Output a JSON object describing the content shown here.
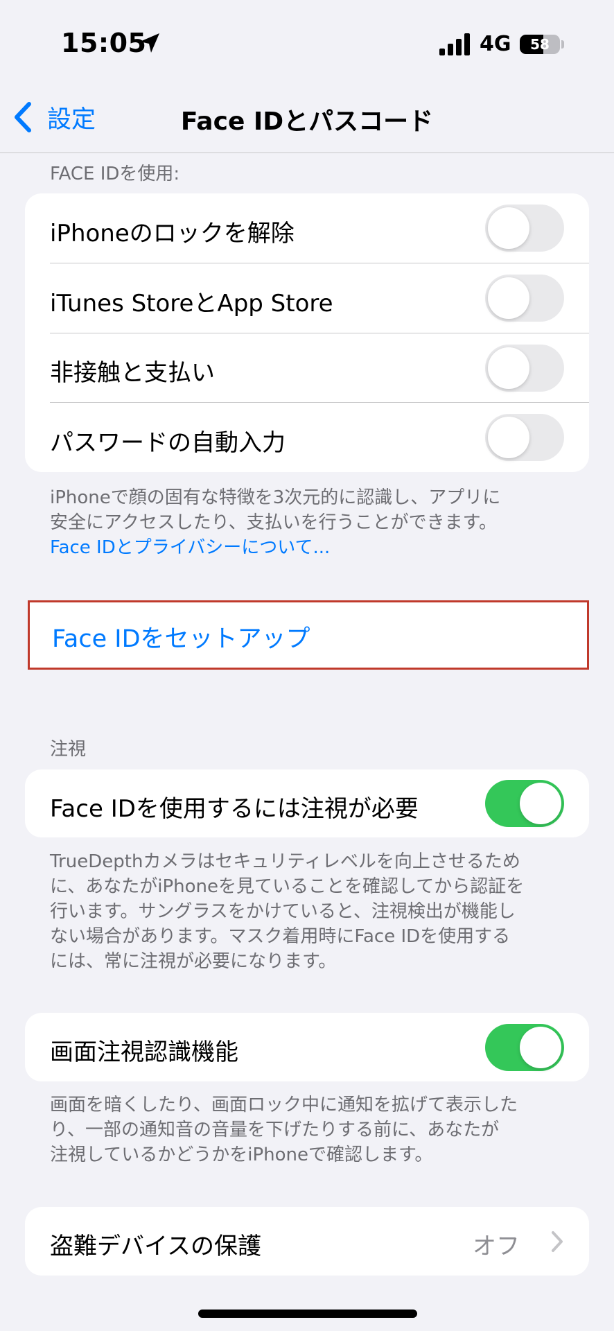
{
  "status_bar": {
    "time": "15:05",
    "network": "4G",
    "battery_level": "58"
  },
  "nav": {
    "back_label": "設定",
    "title": "Face IDとパスコード"
  },
  "face_id_section": {
    "header": "FACE IDを使用:",
    "rows": [
      {
        "label": "iPhoneのロックを解除",
        "toggle": "off"
      },
      {
        "label": "iTunes StoreとApp Store",
        "toggle": "off"
      },
      {
        "label": "非接触と支払い",
        "toggle": "off"
      },
      {
        "label": "パスワードの自動入力",
        "toggle": "off"
      }
    ],
    "footnote_line1": "iPhoneで顔の固有な特徴を3次元的に認識し、アプリに",
    "footnote_line2": "安全にアクセスしたり、支払いを行うことができます。",
    "footnote_link": "Face IDとプライバシーについて..."
  },
  "setup": {
    "label": "Face IDをセットアップ"
  },
  "attention_section": {
    "header": "注視",
    "row_label": "Face IDを使用するには注視が必要",
    "toggle": "on",
    "footnote_lines": [
      "TrueDepthカメラはセキュリティレベルを向上させるため",
      "に、あなたがiPhoneを見ていることを確認してから認証を",
      "行います。サングラスをかけていると、注視検出が機能し",
      "ない場合があります。マスク着用時にFace IDを使用する",
      "には、常に注視が必要になります。"
    ]
  },
  "attention_aware": {
    "row_label": "画面注視認識機能",
    "toggle": "on",
    "footnote_lines": [
      "画面を暗くしたり、画面ロック中に通知を拡げて表示した",
      "り、一部の通知音の音量を下げたりする前に、あなたが",
      "注視しているかどうかをiPhoneで確認します。"
    ]
  },
  "stolen_device": {
    "row_label": "盗難デバイスの保護",
    "value": "オフ"
  },
  "colors": {
    "accent": "#007aff",
    "toggle_on": "#34c759",
    "toggle_off": "#e9e9eb",
    "highlight_border": "#c0392b"
  },
  "icons": [
    "location-arrow-icon",
    "cellular-signal-icon",
    "battery-icon",
    "chevron-left-icon",
    "chevron-right-icon"
  ]
}
